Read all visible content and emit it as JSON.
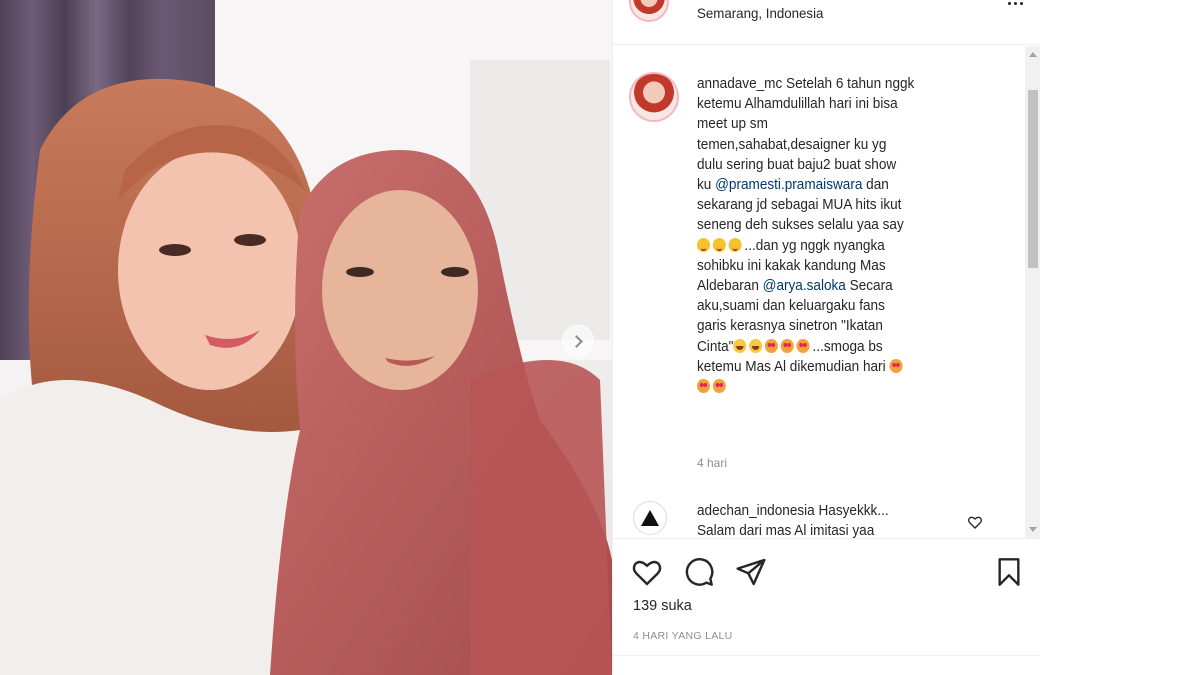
{
  "header": {
    "location": "Semarang, Indonesia"
  },
  "post": {
    "author": "annadave_mc",
    "lines": [
      "Setelah 6 tahun nggk",
      "ketemu Alhamdulillah hari ini bisa",
      "meet up sm",
      "temen,sahabat,desaigner ku yg",
      "dulu sering buat baju2 buat show",
      "ku",
      "dan",
      "sekarang jd sebagai MUA hits ikut",
      "seneng deh sukses selalu yaa say",
      "...dan yg nggk nyangka",
      "sohibku ini kakak kandung Mas",
      "Aldebaran",
      "Secara",
      "aku,suami dan keluargaku fans",
      "garis kerasnya sinetron \"Ikatan",
      "Cinta\"",
      "...smoga bs",
      "ketemu Mas Al dikemudian hari"
    ],
    "mention_1": "@pramesti.pramaiswara",
    "mention_2": "@arya.saloka",
    "time": "4 hari"
  },
  "reply": {
    "author": "adechan_indonesia",
    "text": "Hasyekkk...",
    "text_2": "Salam dari mas Al imitasi yaa"
  },
  "actions": {
    "like_icon": "heart-icon",
    "comment_icon": "comment-icon",
    "share_icon": "paper-plane-icon",
    "save_icon": "bookmark-icon"
  },
  "likes": "139 suka",
  "timestamp": "4 HARI YANG LALU"
}
